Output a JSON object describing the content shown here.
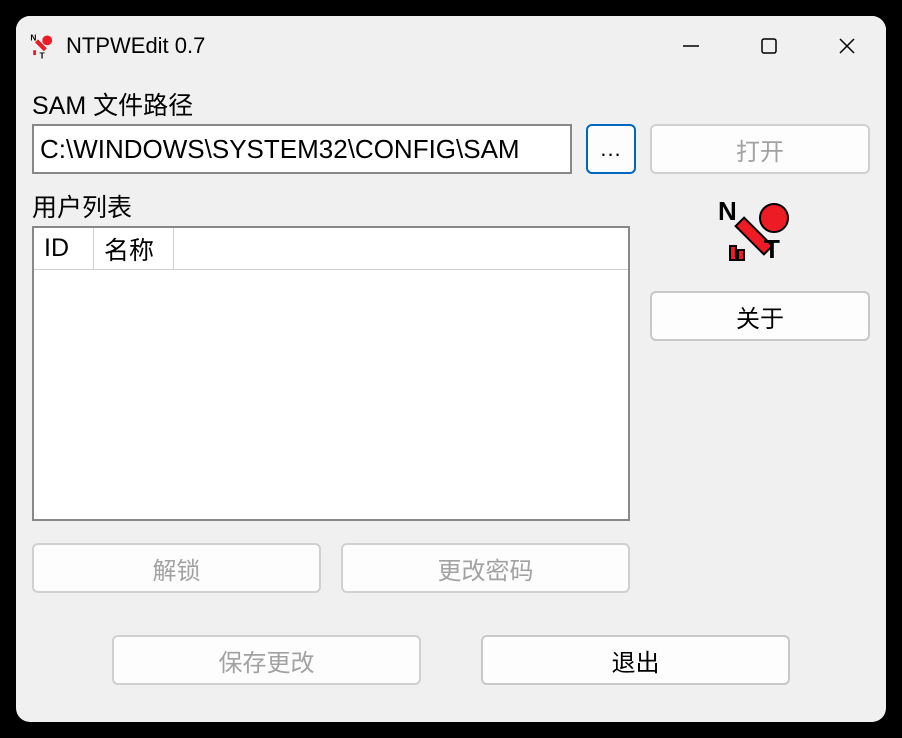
{
  "window": {
    "title": "NTPWEdit 0.7"
  },
  "sam": {
    "label": "SAM 文件路径",
    "path": "C:\\WINDOWS\\SYSTEM32\\CONFIG\\SAM",
    "browse_label": "...",
    "open_label": "打开"
  },
  "userlist": {
    "label": "用户列表",
    "columns": {
      "id": "ID",
      "name": "名称"
    },
    "rows": []
  },
  "buttons": {
    "unlock": "解锁",
    "change_password": "更改密码",
    "about": "关于",
    "save_changes": "保存更改",
    "exit": "退出"
  },
  "colors": {
    "accent": "#0067c0",
    "window_bg": "#f0f0f0",
    "disabled_text": "#a2a2a2",
    "logo_red": "#ed1c24"
  }
}
